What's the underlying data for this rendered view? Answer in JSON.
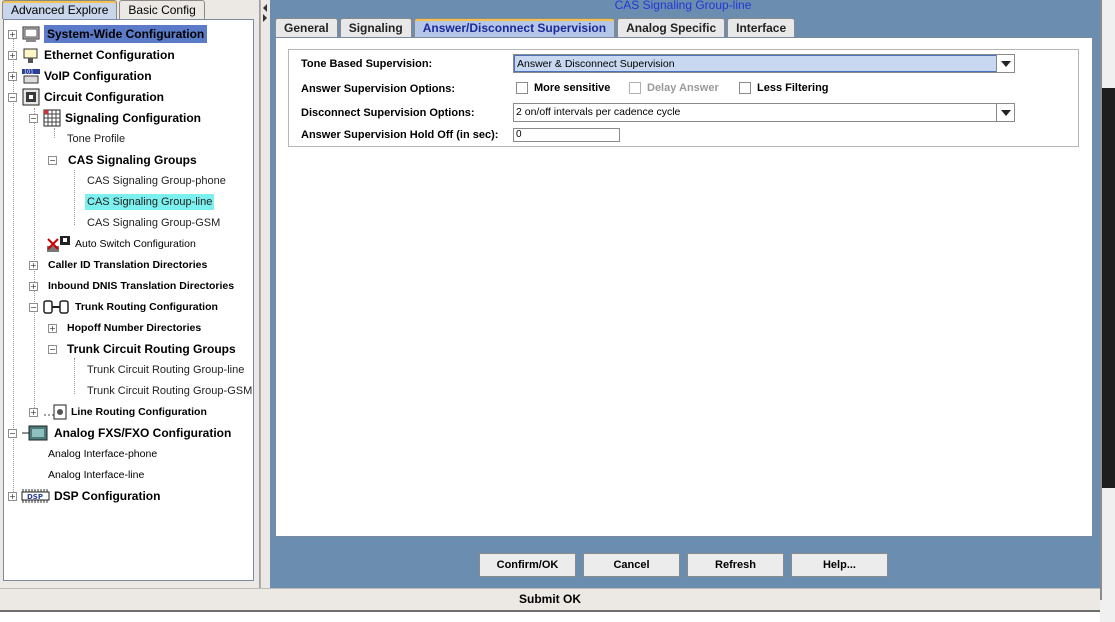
{
  "left_tabs": [
    "Advanced Explore",
    "Basic Config"
  ],
  "tree": {
    "system_wide": "System-Wide Configuration",
    "ethernet": "Ethernet Configuration",
    "voip": "VoIP Configuration",
    "circuit": "Circuit Configuration",
    "signaling": "Signaling Configuration",
    "tone_profile": "Tone Profile",
    "cas_groups": "CAS Signaling Groups",
    "cas_phone": "CAS Signaling Group-phone",
    "cas_line": "CAS Signaling Group-line",
    "cas_gsm": "CAS Signaling Group-GSM",
    "auto_switch": "Auto Switch Configuration",
    "caller_id": "Caller ID Translation Directories",
    "inbound_dnis": "Inbound DNIS Translation Directories",
    "trunk_routing": "Trunk Routing Configuration",
    "hopoff": "Hopoff Number Directories",
    "trunk_groups": "Trunk Circuit Routing Groups",
    "trunk_line": "Trunk Circuit Routing Group-line",
    "trunk_gsm": "Trunk Circuit Routing Group-GSM",
    "line_routing": "Line Routing Configuration",
    "analog_fxs": "Analog FXS/FXO Configuration",
    "analog_phone": "Analog Interface-phone",
    "analog_line": "Analog Interface-line",
    "dsp": "DSP Configuration"
  },
  "panel_title": "CAS Signaling Group-line",
  "tabs": [
    "General",
    "Signaling",
    "Answer/Disconnect Supervision",
    "Analog Specific",
    "Interface"
  ],
  "form": {
    "tone_label": "Tone Based Supervision:",
    "tone_value": "Answer & Disconnect Supervision",
    "answer_opts_label": "Answer Supervision Options:",
    "more_sensitive": "More sensitive",
    "delay_answer": "Delay Answer",
    "less_filtering": "Less Filtering",
    "disconnect_label": "Disconnect Supervision Options:",
    "disconnect_value": "2 on/off intervals per cadence cycle",
    "holdoff_label": "Answer Supervision Hold Off (in sec):",
    "holdoff_value": "0"
  },
  "buttons": {
    "confirm": "Confirm/OK",
    "cancel": "Cancel",
    "refresh": "Refresh",
    "help": "Help..."
  },
  "status": "Submit OK",
  "colors": {
    "panel_bg": "#6a8db0",
    "selected_node": "#7cf0ef",
    "title_text": "#2038d8"
  }
}
